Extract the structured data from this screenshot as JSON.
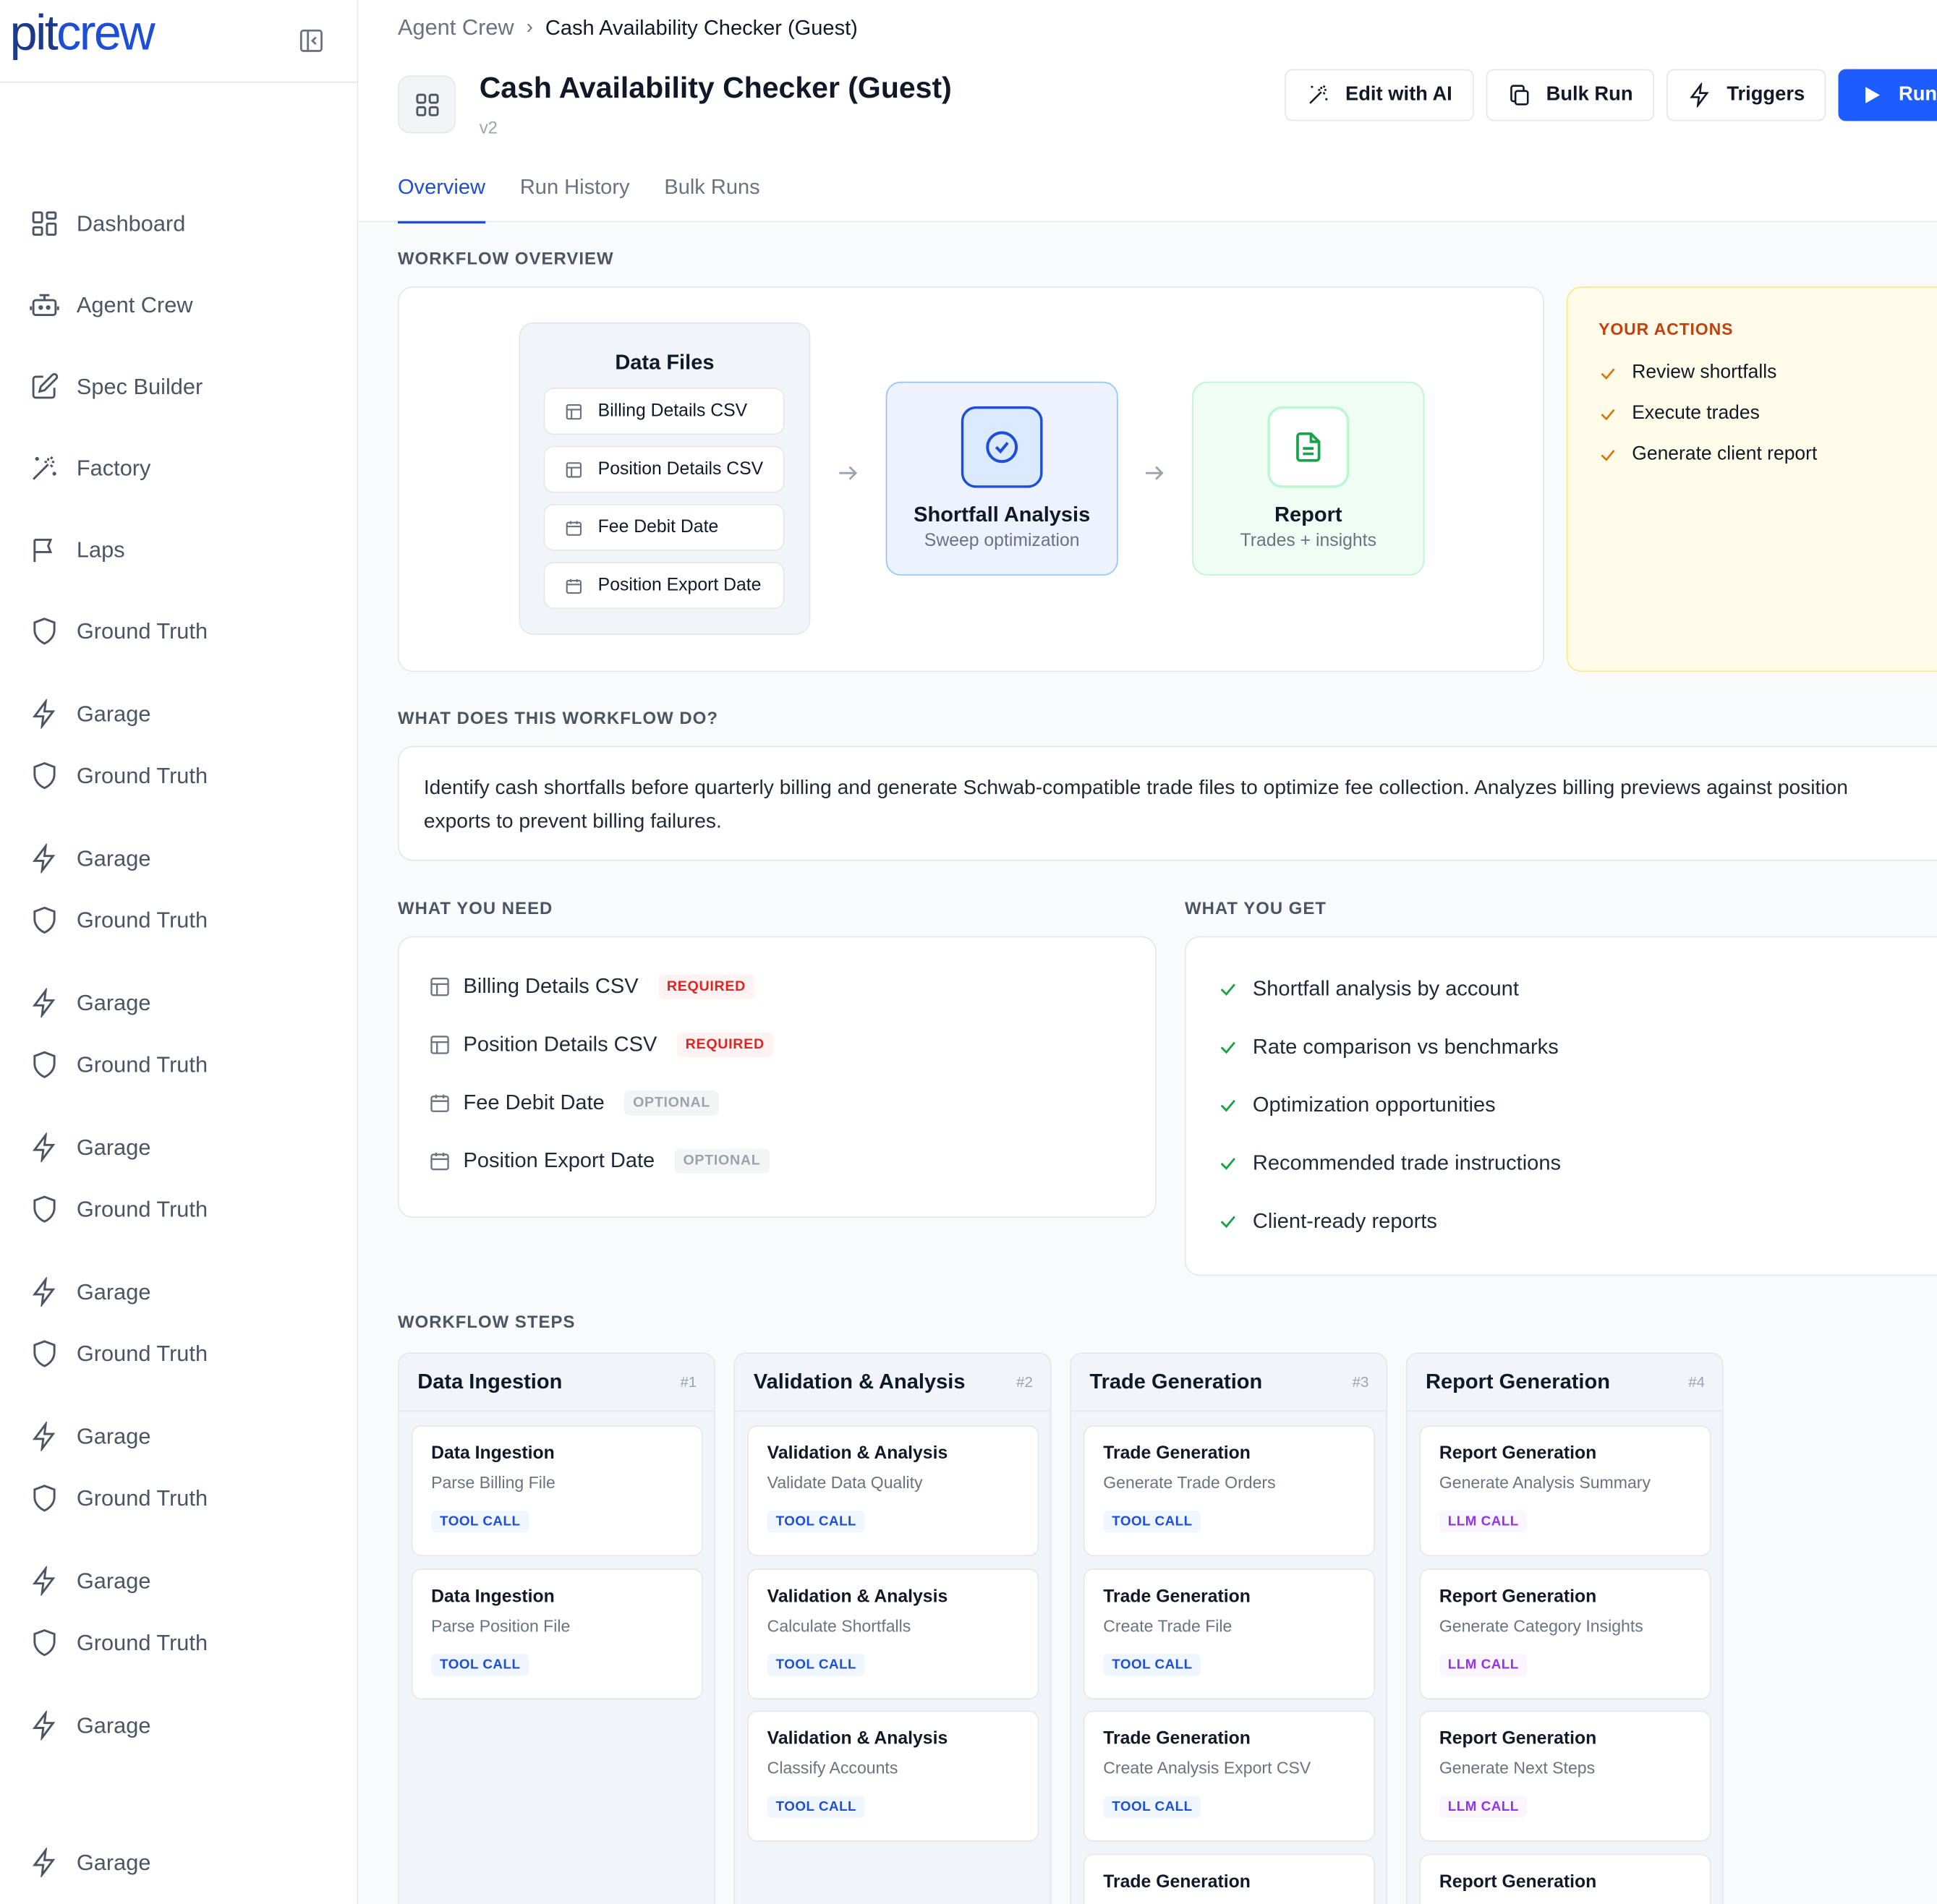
{
  "brand": {
    "pit": "pit",
    "crew": "crew"
  },
  "sidebar": {
    "items": [
      {
        "label": "Dashboard",
        "icon": "grid-icon"
      },
      {
        "label": "Agent Crew",
        "icon": "robot-icon"
      },
      {
        "label": "Spec Builder",
        "icon": "edit-icon"
      },
      {
        "label": "Factory",
        "icon": "magic-wand-icon"
      },
      {
        "label": "Laps",
        "icon": "flag-icon"
      },
      {
        "label": "Ground Truth",
        "icon": "shield-icon"
      },
      {
        "label": "Garage",
        "icon": "bolt-icon"
      },
      {
        "label": "Ground Truth",
        "icon": "shield-icon"
      },
      {
        "label": "Garage",
        "icon": "bolt-icon"
      },
      {
        "label": "Ground Truth",
        "icon": "shield-icon"
      },
      {
        "label": "Garage",
        "icon": "bolt-icon"
      },
      {
        "label": "Ground Truth",
        "icon": "shield-icon"
      },
      {
        "label": "Garage",
        "icon": "bolt-icon"
      },
      {
        "label": "Ground Truth",
        "icon": "shield-icon"
      },
      {
        "label": "Garage",
        "icon": "bolt-icon"
      },
      {
        "label": "Ground Truth",
        "icon": "shield-icon"
      },
      {
        "label": "Garage",
        "icon": "bolt-icon"
      },
      {
        "label": "Ground Truth",
        "icon": "shield-icon"
      },
      {
        "label": "Garage",
        "icon": "bolt-icon"
      },
      {
        "label": "Ground Truth",
        "icon": "shield-icon"
      },
      {
        "label": "Garage",
        "icon": "bolt-icon"
      },
      {
        "label": "Garage",
        "icon": "bolt-icon"
      }
    ]
  },
  "breadcrumb": {
    "parent": "Agent Crew",
    "separator": "›",
    "current": "Cash Availability Checker (Guest)"
  },
  "header": {
    "title": "Cash Availability Checker (Guest)",
    "version": "v2",
    "buttons": {
      "edit_ai": "Edit with AI",
      "bulk_run": "Bulk Run",
      "triggers": "Triggers",
      "run": "Run"
    }
  },
  "tabs": [
    "Overview",
    "Run History",
    "Bulk Runs"
  ],
  "overview": {
    "section_label": "WORKFLOW OVERVIEW",
    "data_files": {
      "title": "Data Files",
      "items": [
        "Billing Details CSV",
        "Position Details CSV",
        "Fee Debit Date",
        "Position Export Date"
      ]
    },
    "analysis": {
      "title": "Shortfall Analysis",
      "subtitle": "Sweep optimization"
    },
    "report": {
      "title": "Report",
      "subtitle": "Trades + insights"
    },
    "your_actions": {
      "title": "YOUR ACTIONS",
      "items": [
        "Review shortfalls",
        "Execute trades",
        "Generate client report"
      ]
    }
  },
  "description": {
    "section_label": "WHAT DOES THIS WORKFLOW DO?",
    "text": "Identify cash shortfalls before quarterly billing and generate Schwab-compatible trade files to optimize fee collection. Analyzes billing previews against position exports to prevent billing failures."
  },
  "needs": {
    "section_label": "WHAT YOU NEED",
    "items": [
      {
        "label": "Billing Details CSV",
        "badge": "REQUIRED"
      },
      {
        "label": "Position Details CSV",
        "badge": "REQUIRED"
      },
      {
        "label": "Fee Debit Date",
        "badge": "OPTIONAL"
      },
      {
        "label": "Position Export Date",
        "badge": "OPTIONAL"
      }
    ]
  },
  "gets": {
    "section_label": "WHAT YOU GET",
    "items": [
      "Shortfall analysis by account",
      "Rate comparison vs benchmarks",
      "Optimization opportunities",
      "Recommended trade instructions",
      "Client-ready reports"
    ]
  },
  "steps": {
    "section_label": "WORKFLOW STEPS",
    "columns": [
      {
        "title": "Data Ingestion",
        "num": "#1",
        "cards": [
          {
            "title": "Data Ingestion",
            "sub": "Parse Billing File",
            "badge": "TOOL CALL"
          },
          {
            "title": "Data Ingestion",
            "sub": "Parse Position File",
            "badge": "TOOL CALL"
          }
        ]
      },
      {
        "title": "Validation & Analysis",
        "num": "#2",
        "cards": [
          {
            "title": "Validation & Analysis",
            "sub": "Validate Data Quality",
            "badge": "TOOL CALL"
          },
          {
            "title": "Validation & Analysis",
            "sub": "Calculate Shortfalls",
            "badge": "TOOL CALL"
          },
          {
            "title": "Validation & Analysis",
            "sub": "Classify Accounts",
            "badge": "TOOL CALL"
          }
        ]
      },
      {
        "title": "Trade Generation",
        "num": "#3",
        "cards": [
          {
            "title": "Trade Generation",
            "sub": "Generate Trade Orders",
            "badge": "TOOL CALL"
          },
          {
            "title": "Trade Generation",
            "sub": "Create Trade File",
            "badge": "TOOL CALL"
          },
          {
            "title": "Trade Generation",
            "sub": "Create Analysis Export CSV",
            "badge": "TOOL CALL"
          },
          {
            "title": "Trade Generation",
            "sub": "",
            "badge": ""
          }
        ]
      },
      {
        "title": "Report Generation",
        "num": "#4",
        "cards": [
          {
            "title": "Report Generation",
            "sub": "Generate Analysis Summary",
            "badge": "LLM CALL"
          },
          {
            "title": "Report Generation",
            "sub": "Generate Category Insights",
            "badge": "LLM CALL"
          },
          {
            "title": "Report Generation",
            "sub": "Generate Next Steps",
            "badge": "LLM CALL"
          },
          {
            "title": "Report Generation",
            "sub": "",
            "badge": ""
          }
        ]
      }
    ]
  },
  "colors": {
    "accent": "#1d5cff",
    "brand": "#1d4ed8",
    "required": "#dc2626",
    "success": "#16a34a",
    "actions_bg": "#fefce8",
    "llm": "#9333ea"
  }
}
